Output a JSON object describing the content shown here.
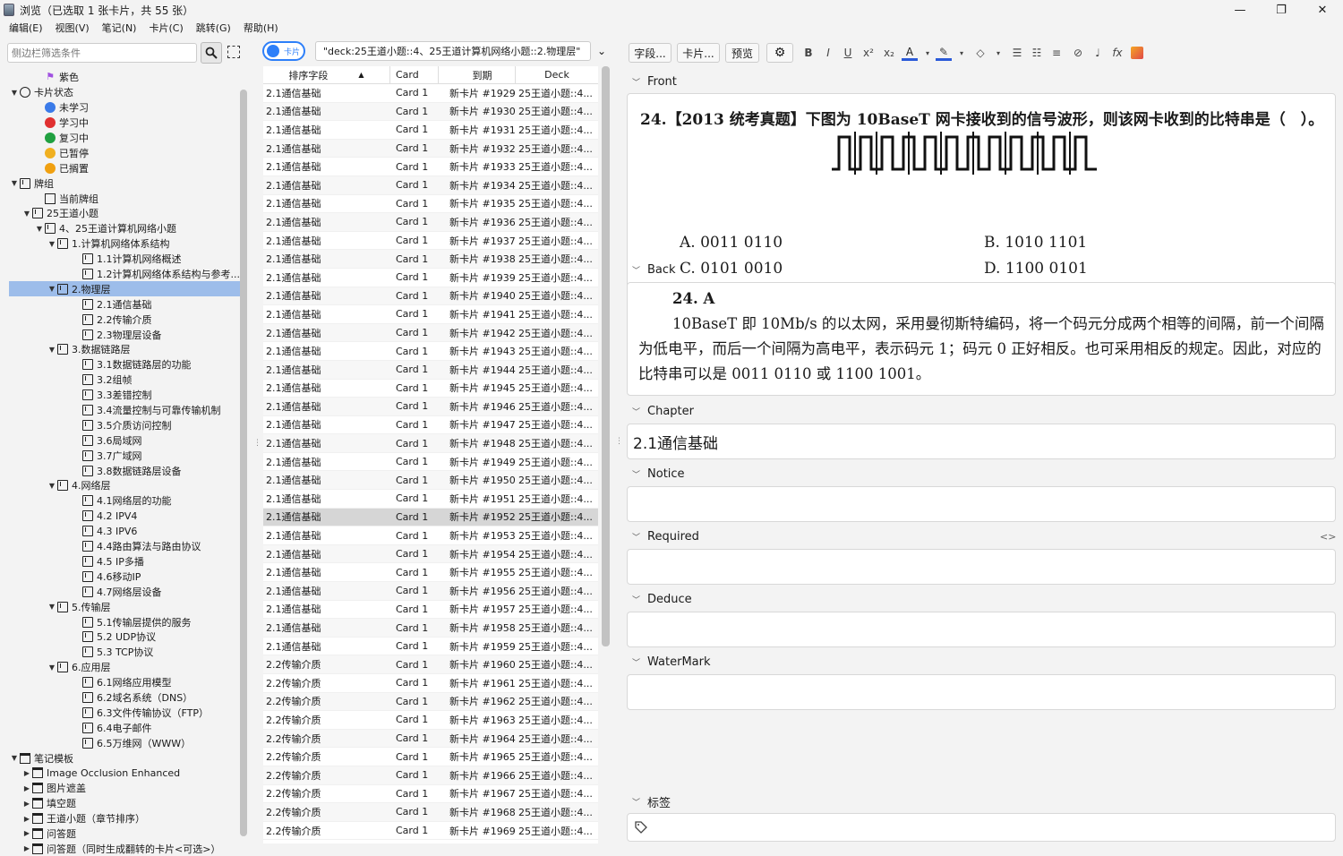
{
  "window": {
    "title": "浏览（已选取 1 张卡片，共 55 张）"
  },
  "menu": [
    "编辑(E)",
    "视图(V)",
    "笔记(N)",
    "卡片(C)",
    "跳转(G)",
    "帮助(H)"
  ],
  "sidebar": {
    "filter_placeholder": "侧边栏筛选条件",
    "tree": [
      {
        "t": "紫色",
        "lvl": 2,
        "icon": "flag",
        "arrow": ""
      },
      {
        "t": "卡片状态",
        "lvl": 0,
        "icon": "ring",
        "arrow": "v"
      },
      {
        "t": "未学习",
        "lvl": 2,
        "icon": "dot",
        "color": "#3a7ae8",
        "arrow": ""
      },
      {
        "t": "学习中",
        "lvl": 2,
        "icon": "dot",
        "color": "#e03030",
        "arrow": ""
      },
      {
        "t": "复习中",
        "lvl": 2,
        "icon": "dot",
        "color": "#20a040",
        "arrow": ""
      },
      {
        "t": "已暂停",
        "lvl": 2,
        "icon": "dot",
        "color": "#f0b020",
        "arrow": ""
      },
      {
        "t": "已搁置",
        "lvl": 2,
        "icon": "dot",
        "color": "#f0a010",
        "arrow": ""
      },
      {
        "t": "牌组",
        "lvl": 0,
        "icon": "deck",
        "arrow": "v"
      },
      {
        "t": "当前牌组",
        "lvl": 2,
        "icon": "current",
        "arrow": ""
      },
      {
        "t": "25王道小题",
        "lvl": 1,
        "icon": "deck",
        "arrow": "v"
      },
      {
        "t": "4、25王道计算机网络小题",
        "lvl": 2,
        "icon": "deck",
        "arrow": "v"
      },
      {
        "t": "1.计算机网络体系结构",
        "lvl": 3,
        "icon": "deck",
        "arrow": "v"
      },
      {
        "t": "1.1计算机网络概述",
        "lvl": 5,
        "icon": "deck",
        "arrow": ""
      },
      {
        "t": "1.2计算机网络体系结构与参考...",
        "lvl": 5,
        "icon": "deck",
        "arrow": ""
      },
      {
        "t": "2.物理层",
        "lvl": 3,
        "icon": "deck",
        "arrow": "v",
        "selected": true
      },
      {
        "t": "2.1通信基础",
        "lvl": 5,
        "icon": "deck",
        "arrow": ""
      },
      {
        "t": "2.2传输介质",
        "lvl": 5,
        "icon": "deck",
        "arrow": ""
      },
      {
        "t": "2.3物理层设备",
        "lvl": 5,
        "icon": "deck",
        "arrow": ""
      },
      {
        "t": "3.数据链路层",
        "lvl": 3,
        "icon": "deck",
        "arrow": "v"
      },
      {
        "t": "3.1数据链路层的功能",
        "lvl": 5,
        "icon": "deck",
        "arrow": ""
      },
      {
        "t": "3.2组帧",
        "lvl": 5,
        "icon": "deck",
        "arrow": ""
      },
      {
        "t": "3.3差错控制",
        "lvl": 5,
        "icon": "deck",
        "arrow": ""
      },
      {
        "t": "3.4流量控制与可靠传输机制",
        "lvl": 5,
        "icon": "deck",
        "arrow": ""
      },
      {
        "t": "3.5介质访问控制",
        "lvl": 5,
        "icon": "deck",
        "arrow": ""
      },
      {
        "t": "3.6局域网",
        "lvl": 5,
        "icon": "deck",
        "arrow": ""
      },
      {
        "t": "3.7广域网",
        "lvl": 5,
        "icon": "deck",
        "arrow": ""
      },
      {
        "t": "3.8数据链路层设备",
        "lvl": 5,
        "icon": "deck",
        "arrow": ""
      },
      {
        "t": "4.网络层",
        "lvl": 3,
        "icon": "deck",
        "arrow": "v"
      },
      {
        "t": "4.1网络层的功能",
        "lvl": 5,
        "icon": "deck",
        "arrow": ""
      },
      {
        "t": "4.2 IPV4",
        "lvl": 5,
        "icon": "deck",
        "arrow": ""
      },
      {
        "t": "4.3 IPV6",
        "lvl": 5,
        "icon": "deck",
        "arrow": ""
      },
      {
        "t": "4.4路由算法与路由协议",
        "lvl": 5,
        "icon": "deck",
        "arrow": ""
      },
      {
        "t": "4.5 IP多播",
        "lvl": 5,
        "icon": "deck",
        "arrow": ""
      },
      {
        "t": "4.6移动IP",
        "lvl": 5,
        "icon": "deck",
        "arrow": ""
      },
      {
        "t": "4.7网络层设备",
        "lvl": 5,
        "icon": "deck",
        "arrow": ""
      },
      {
        "t": "5.传输层",
        "lvl": 3,
        "icon": "deck",
        "arrow": "v"
      },
      {
        "t": "5.1传输层提供的服务",
        "lvl": 5,
        "icon": "deck",
        "arrow": ""
      },
      {
        "t": "5.2 UDP协议",
        "lvl": 5,
        "icon": "deck",
        "arrow": ""
      },
      {
        "t": "5.3 TCP协议",
        "lvl": 5,
        "icon": "deck",
        "arrow": ""
      },
      {
        "t": "6.应用层",
        "lvl": 3,
        "icon": "deck",
        "arrow": "v"
      },
      {
        "t": "6.1网络应用模型",
        "lvl": 5,
        "icon": "deck",
        "arrow": ""
      },
      {
        "t": "6.2域名系统（DNS）",
        "lvl": 5,
        "icon": "deck",
        "arrow": ""
      },
      {
        "t": "6.3文件传输协议（FTP）",
        "lvl": 5,
        "icon": "deck",
        "arrow": ""
      },
      {
        "t": "6.4电子邮件",
        "lvl": 5,
        "icon": "deck",
        "arrow": ""
      },
      {
        "t": "6.5万维网（WWW）",
        "lvl": 5,
        "icon": "deck",
        "arrow": ""
      },
      {
        "t": "笔记模板",
        "lvl": 0,
        "icon": "note",
        "arrow": "v"
      },
      {
        "t": "Image Occlusion Enhanced",
        "lvl": 1,
        "icon": "note",
        "arrow": ">"
      },
      {
        "t": "图片遮盖",
        "lvl": 1,
        "icon": "note",
        "arrow": ">"
      },
      {
        "t": "填空题",
        "lvl": 1,
        "icon": "note",
        "arrow": ">"
      },
      {
        "t": "王道小题（章节排序）",
        "lvl": 1,
        "icon": "note",
        "arrow": ">"
      },
      {
        "t": "问答题",
        "lvl": 1,
        "icon": "note",
        "arrow": ">"
      },
      {
        "t": "问答题（同时生成翻转的卡片<可选>）",
        "lvl": 1,
        "icon": "note",
        "arrow": ">"
      }
    ]
  },
  "table": {
    "toggle_label": "卡片",
    "query": "\"deck:25王道小题::4、25王道计算机网络小题::2.物理层\"",
    "columns": [
      "排序字段",
      "Card",
      "到期",
      "Deck"
    ],
    "rows": [
      [
        "2.1通信基础",
        "Card 1",
        "新卡片 #1929",
        "25王道小题::4..."
      ],
      [
        "2.1通信基础",
        "Card 1",
        "新卡片 #1930",
        "25王道小题::4..."
      ],
      [
        "2.1通信基础",
        "Card 1",
        "新卡片 #1931",
        "25王道小题::4..."
      ],
      [
        "2.1通信基础",
        "Card 1",
        "新卡片 #1932",
        "25王道小题::4..."
      ],
      [
        "2.1通信基础",
        "Card 1",
        "新卡片 #1933",
        "25王道小题::4..."
      ],
      [
        "2.1通信基础",
        "Card 1",
        "新卡片 #1934",
        "25王道小题::4..."
      ],
      [
        "2.1通信基础",
        "Card 1",
        "新卡片 #1935",
        "25王道小题::4..."
      ],
      [
        "2.1通信基础",
        "Card 1",
        "新卡片 #1936",
        "25王道小题::4..."
      ],
      [
        "2.1通信基础",
        "Card 1",
        "新卡片 #1937",
        "25王道小题::4..."
      ],
      [
        "2.1通信基础",
        "Card 1",
        "新卡片 #1938",
        "25王道小题::4..."
      ],
      [
        "2.1通信基础",
        "Card 1",
        "新卡片 #1939",
        "25王道小题::4..."
      ],
      [
        "2.1通信基础",
        "Card 1",
        "新卡片 #1940",
        "25王道小题::4..."
      ],
      [
        "2.1通信基础",
        "Card 1",
        "新卡片 #1941",
        "25王道小题::4..."
      ],
      [
        "2.1通信基础",
        "Card 1",
        "新卡片 #1942",
        "25王道小题::4..."
      ],
      [
        "2.1通信基础",
        "Card 1",
        "新卡片 #1943",
        "25王道小题::4..."
      ],
      [
        "2.1通信基础",
        "Card 1",
        "新卡片 #1944",
        "25王道小题::4..."
      ],
      [
        "2.1通信基础",
        "Card 1",
        "新卡片 #1945",
        "25王道小题::4..."
      ],
      [
        "2.1通信基础",
        "Card 1",
        "新卡片 #1946",
        "25王道小题::4..."
      ],
      [
        "2.1通信基础",
        "Card 1",
        "新卡片 #1947",
        "25王道小题::4..."
      ],
      [
        "2.1通信基础",
        "Card 1",
        "新卡片 #1948",
        "25王道小题::4..."
      ],
      [
        "2.1通信基础",
        "Card 1",
        "新卡片 #1949",
        "25王道小题::4..."
      ],
      [
        "2.1通信基础",
        "Card 1",
        "新卡片 #1950",
        "25王道小题::4..."
      ],
      [
        "2.1通信基础",
        "Card 1",
        "新卡片 #1951",
        "25王道小题::4..."
      ],
      [
        "2.1通信基础",
        "Card 1",
        "新卡片 #1952",
        "25王道小题::4..."
      ],
      [
        "2.1通信基础",
        "Card 1",
        "新卡片 #1953",
        "25王道小题::4..."
      ],
      [
        "2.1通信基础",
        "Card 1",
        "新卡片 #1954",
        "25王道小题::4..."
      ],
      [
        "2.1通信基础",
        "Card 1",
        "新卡片 #1955",
        "25王道小题::4..."
      ],
      [
        "2.1通信基础",
        "Card 1",
        "新卡片 #1956",
        "25王道小题::4..."
      ],
      [
        "2.1通信基础",
        "Card 1",
        "新卡片 #1957",
        "25王道小题::4..."
      ],
      [
        "2.1通信基础",
        "Card 1",
        "新卡片 #1958",
        "25王道小题::4..."
      ],
      [
        "2.1通信基础",
        "Card 1",
        "新卡片 #1959",
        "25王道小题::4..."
      ],
      [
        "2.2传输介质",
        "Card 1",
        "新卡片 #1960",
        "25王道小题::4..."
      ],
      [
        "2.2传输介质",
        "Card 1",
        "新卡片 #1961",
        "25王道小题::4..."
      ],
      [
        "2.2传输介质",
        "Card 1",
        "新卡片 #1962",
        "25王道小题::4..."
      ],
      [
        "2.2传输介质",
        "Card 1",
        "新卡片 #1963",
        "25王道小题::4..."
      ],
      [
        "2.2传输介质",
        "Card 1",
        "新卡片 #1964",
        "25王道小题::4..."
      ],
      [
        "2.2传输介质",
        "Card 1",
        "新卡片 #1965",
        "25王道小题::4..."
      ],
      [
        "2.2传输介质",
        "Card 1",
        "新卡片 #1966",
        "25王道小题::4..."
      ],
      [
        "2.2传输介质",
        "Card 1",
        "新卡片 #1967",
        "25王道小题::4..."
      ],
      [
        "2.2传输介质",
        "Card 1",
        "新卡片 #1968",
        "25王道小题::4..."
      ],
      [
        "2.2传输介质",
        "Card 1",
        "新卡片 #1969",
        "25王道小题::4..."
      ]
    ],
    "selected_row": 23
  },
  "editor": {
    "toolbar": {
      "fields_btn": "字段...",
      "cards_btn": "卡片...",
      "preview_btn": "预览"
    },
    "front_label": "Front",
    "front": {
      "question": "24.【2013 统考真题】下图为 10BaseT 网卡接收到的信号波形，则该网卡收到的比特串是（　）。",
      "opt_a": "A.  0011 0110",
      "opt_b": "B.  1010 1101",
      "opt_c": "C.  0101 0010",
      "opt_d": "D.  1100 0101"
    },
    "back_label": "Back",
    "back": {
      "answer": "24.  A",
      "explain": "10BaseT 即 10Mb/s 的以太网，采用曼彻斯特编码，将一个码元分成两个相等的间隔，前一个间隔为低电平，而后一个间隔为高电平，表示码元 1；码元 0 正好相反。也可采用相反的规定。因此，对应的比特串可以是 0011 0110 或 1100 1001。"
    },
    "chapter_label": "Chapter",
    "chapter": "2.1通信基础",
    "notice_label": "Notice",
    "required_label": "Required",
    "deduce_label": "Deduce",
    "watermark_label": "WaterMark",
    "tags_label": "标签"
  }
}
